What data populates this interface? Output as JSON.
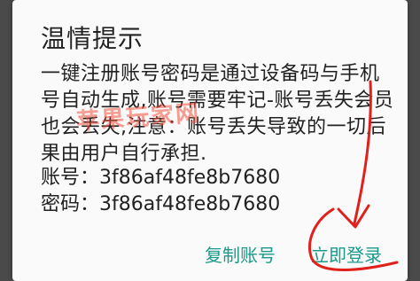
{
  "dialog": {
    "title": "温情提示",
    "message": "一键注册账号密码是通过设备码与手机号自动生成,账号需要牢记-账号丢失会员也会丢失,注意：账号丢失导致的一切后果由用户自行承担.",
    "account_label": "账号：",
    "account_value": "3f86af48fe8b7680",
    "password_label": "密码：",
    "password_value": "3f86af48fe8b7680",
    "copy_button": "复制账号",
    "login_button": "立即登录"
  },
  "watermark": {
    "text": "苹果玩家网"
  },
  "colors": {
    "accent": "#1a9a8a",
    "annotation": "#e0201a"
  }
}
